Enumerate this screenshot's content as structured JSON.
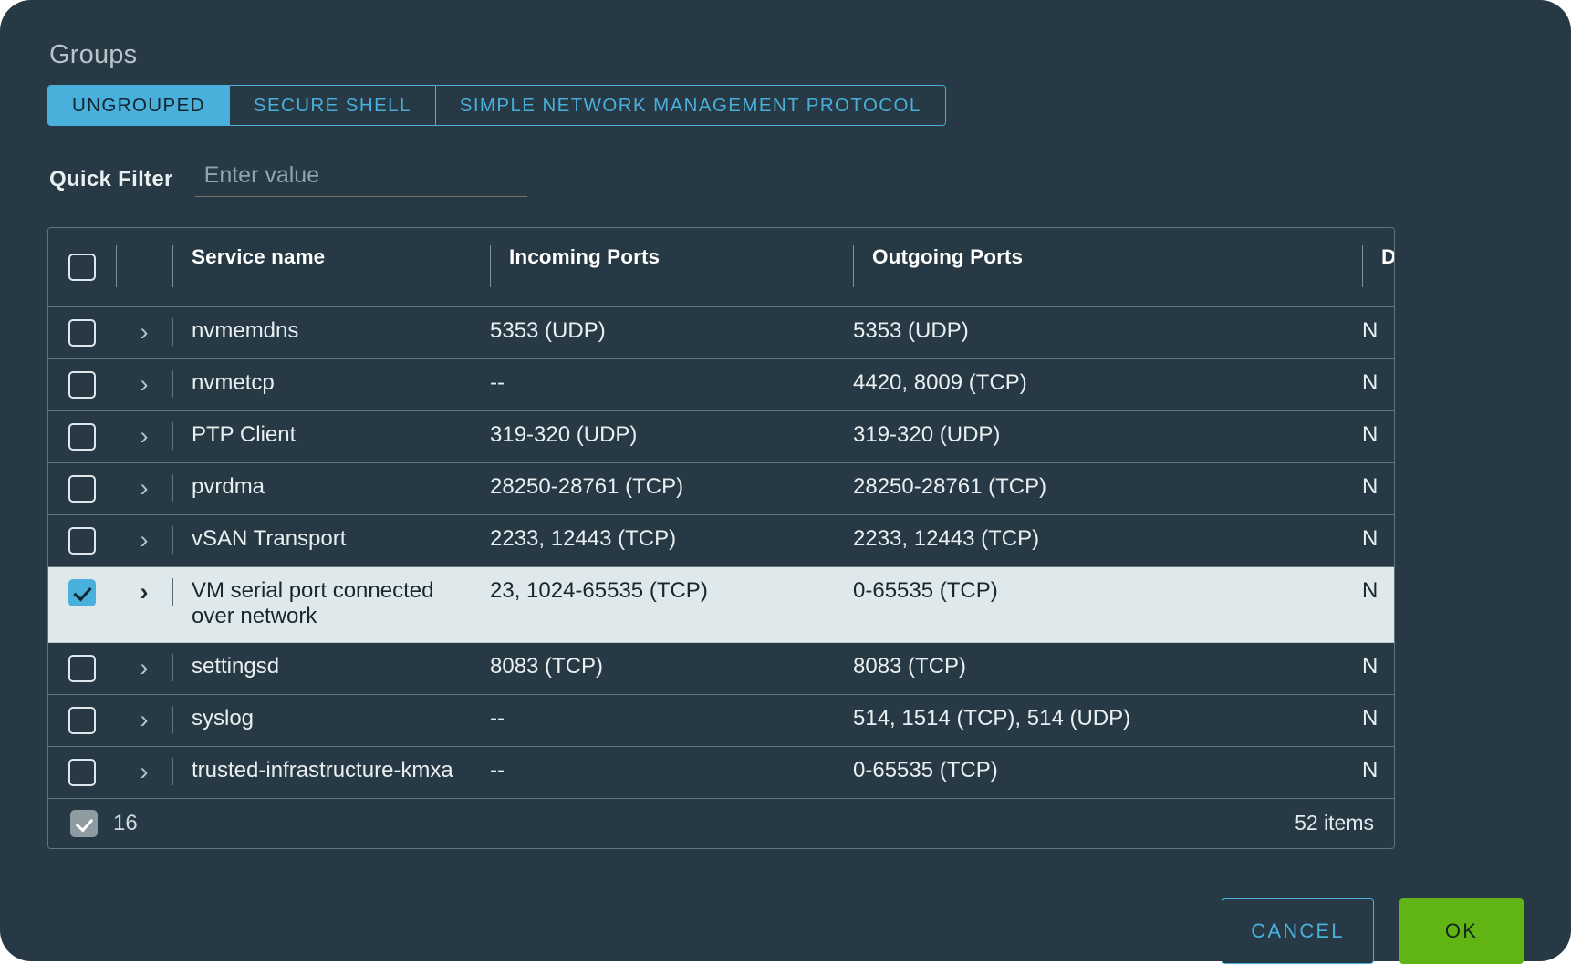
{
  "dialog": {
    "groups_label": "Groups",
    "tabs": [
      {
        "label": "UNGROUPED",
        "active": true
      },
      {
        "label": "SECURE SHELL",
        "active": false
      },
      {
        "label": "SIMPLE NETWORK MANAGEMENT PROTOCOL",
        "active": false
      }
    ]
  },
  "filter": {
    "label": "Quick Filter",
    "placeholder": "Enter value",
    "value": ""
  },
  "table": {
    "columns": {
      "select": "",
      "expand": "",
      "service_name": "Service name",
      "incoming_ports": "Incoming Ports",
      "outgoing_ports": "Outgoing Ports",
      "daemon": "D"
    },
    "rows": [
      {
        "checked": false,
        "chevron": "›",
        "service_name": "nvmemdns",
        "incoming_ports": "5353 (UDP)",
        "outgoing_ports": "5353 (UDP)",
        "daemon": "N"
      },
      {
        "checked": false,
        "chevron": "›",
        "service_name": "nvmetcp",
        "incoming_ports": "--",
        "outgoing_ports": "4420, 8009 (TCP)",
        "daemon": "N"
      },
      {
        "checked": false,
        "chevron": "›",
        "service_name": "PTP Client",
        "incoming_ports": "319-320 (UDP)",
        "outgoing_ports": "319-320 (UDP)",
        "daemon": "N"
      },
      {
        "checked": false,
        "chevron": "›",
        "service_name": "pvrdma",
        "incoming_ports": "28250-28761 (TCP)",
        "outgoing_ports": "28250-28761 (TCP)",
        "daemon": "N"
      },
      {
        "checked": false,
        "chevron": "›",
        "service_name": "vSAN Transport",
        "incoming_ports": "2233, 12443 (TCP)",
        "outgoing_ports": "2233, 12443 (TCP)",
        "daemon": "N"
      },
      {
        "checked": true,
        "chevron": "›",
        "service_name": "VM serial port connected over network",
        "incoming_ports": "23, 1024-65535 (TCP)",
        "outgoing_ports": "0-65535 (TCP)",
        "daemon": "N"
      },
      {
        "checked": false,
        "chevron": "›",
        "service_name": "settingsd",
        "incoming_ports": "8083 (TCP)",
        "outgoing_ports": "8083 (TCP)",
        "daemon": "N"
      },
      {
        "checked": false,
        "chevron": "›",
        "service_name": "syslog",
        "incoming_ports": "--",
        "outgoing_ports": "514, 1514 (TCP), 514 (UDP)",
        "daemon": "N"
      },
      {
        "checked": false,
        "chevron": "›",
        "service_name": "trusted-infrastructure-kmxa",
        "incoming_ports": "--",
        "outgoing_ports": "0-65535 (TCP)",
        "daemon": "N"
      }
    ],
    "footer": {
      "selected_count": "16",
      "total_items": "52 items"
    }
  },
  "actions": {
    "cancel_label": "CANCEL",
    "ok_label": "OK"
  },
  "colors": {
    "background": "#263944",
    "accent_blue": "#49afdb",
    "ok_green": "#60b515",
    "selected_row": "#dfe8ea",
    "border": "#62747c"
  }
}
